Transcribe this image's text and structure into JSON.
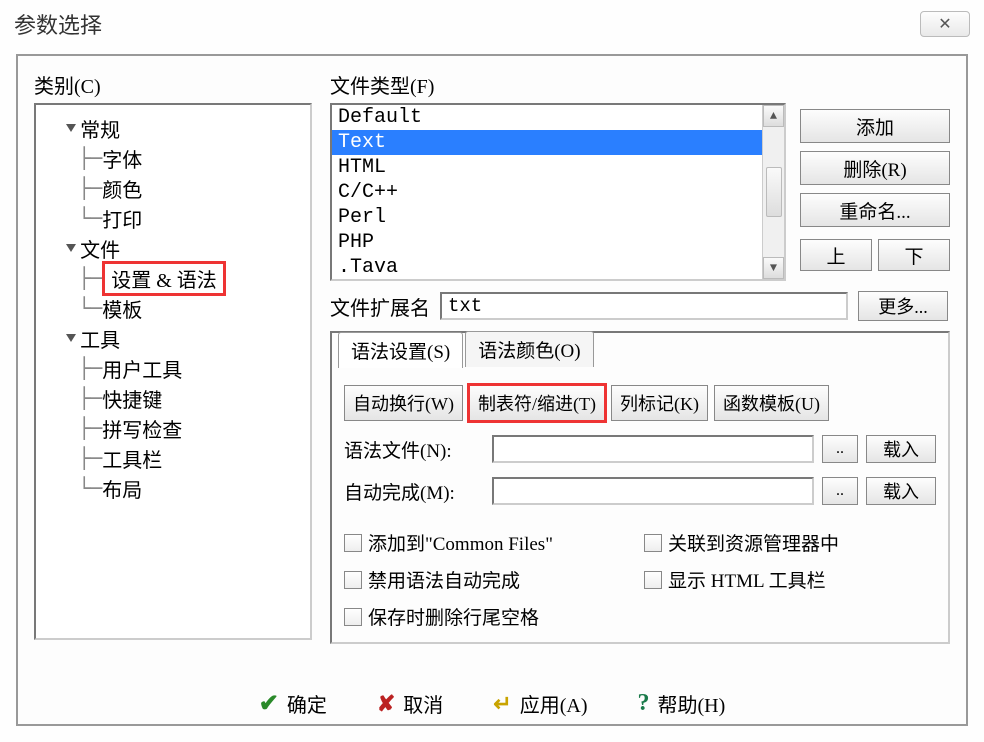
{
  "window": {
    "title": "参数选择",
    "close_glyph": "✕"
  },
  "category": {
    "label": "类别(C)",
    "tree": {
      "general": {
        "label": "常规",
        "children": {
          "font": "字体",
          "color": "颜色",
          "print": "打印"
        }
      },
      "file": {
        "label": "文件",
        "children": {
          "settings_syntax": "设置 & 语法",
          "template": "模板"
        }
      },
      "tool": {
        "label": "工具",
        "children": {
          "user_tool": "用户工具",
          "shortcut": "快捷键",
          "spellcheck": "拼写检查",
          "toolbar": "工具栏",
          "layout": "布局"
        }
      }
    }
  },
  "filetype": {
    "label": "文件类型(F)",
    "items": [
      "Default",
      "Text",
      "HTML",
      "C/C++",
      "Perl",
      "PHP",
      ".Tava"
    ],
    "selected_index": 1,
    "buttons": {
      "add": "添加",
      "delete": "删除(R)",
      "rename": "重命名...",
      "up": "上",
      "down": "下"
    }
  },
  "extension": {
    "label": "文件扩展名",
    "value": "txt",
    "more": "更多..."
  },
  "tabs": {
    "syntax_settings": "语法设置(S)",
    "syntax_colors": "语法颜色(O)"
  },
  "subtabs": {
    "wordwrap": "自动换行(W)",
    "tab_indent": "制表符/缩进(T)",
    "column_marker": "列标记(K)",
    "func_template": "函数模板(U)"
  },
  "fields": {
    "syntax_file": {
      "label": "语法文件(N):",
      "value": "",
      "browse": "..",
      "load": "载入"
    },
    "auto_complete": {
      "label": "自动完成(M):",
      "value": "",
      "browse": "..",
      "load": "载入"
    }
  },
  "checks": {
    "add_common": "添加到\"Common Files\"",
    "assoc_explorer": "关联到资源管理器中",
    "disable_ac": "禁用语法自动完成",
    "show_html_tb": "显示 HTML 工具栏",
    "trim_trailing": "保存时删除行尾空格"
  },
  "footer": {
    "ok": "确定",
    "cancel": "取消",
    "apply": "应用(A)",
    "help": "帮助(H)"
  }
}
